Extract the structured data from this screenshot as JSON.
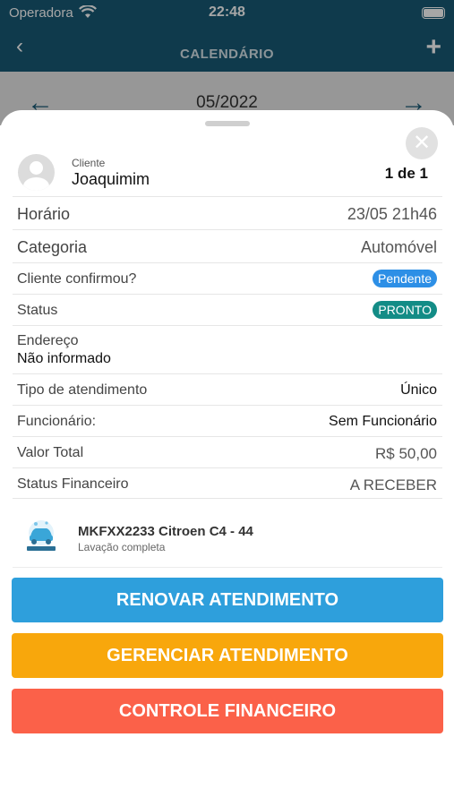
{
  "status_bar": {
    "carrier": "Operadora",
    "time": "22:48"
  },
  "nav": {
    "title": "CALENDÁRIO"
  },
  "month_bar": {
    "month": "05/2022"
  },
  "client": {
    "label": "Cliente",
    "name": "Joaquimim",
    "counter": "1 de 1"
  },
  "details": {
    "horario": {
      "label": "Horário",
      "value": "23/05 21h46"
    },
    "categoria": {
      "label": "Categoria",
      "value": "Automóvel"
    },
    "confirmou": {
      "label": "Cliente confirmou?",
      "value": "Pendente"
    },
    "status": {
      "label": "Status",
      "value": "PRONTO"
    },
    "endereco": {
      "label": "Endereço",
      "value": "Não informado"
    },
    "tipo": {
      "label": "Tipo de atendimento",
      "value": "Único"
    },
    "funcionario": {
      "label": "Funcionário:",
      "value": "Sem Funcionário"
    },
    "valor": {
      "label": "Valor Total",
      "value": "R$ 50,00"
    },
    "status_financeiro": {
      "label": "Status Financeiro",
      "value": "A RECEBER"
    }
  },
  "vehicle": {
    "title": "MKFXX2233 Citroen C4 - 44",
    "service": "Lavação completa"
  },
  "buttons": {
    "renovar": "RENOVAR ATENDIMENTO",
    "gerenciar": "GERENCIAR ATENDIMENTO",
    "financeiro": "CONTROLE FINANCEIRO"
  },
  "colors": {
    "primary": "#175a75",
    "blue_button": "#2e9fdc",
    "orange_button": "#f8a70c",
    "red_button": "#fb6149",
    "pending_badge": "#2d8fe6",
    "ready_badge": "#138c86"
  }
}
